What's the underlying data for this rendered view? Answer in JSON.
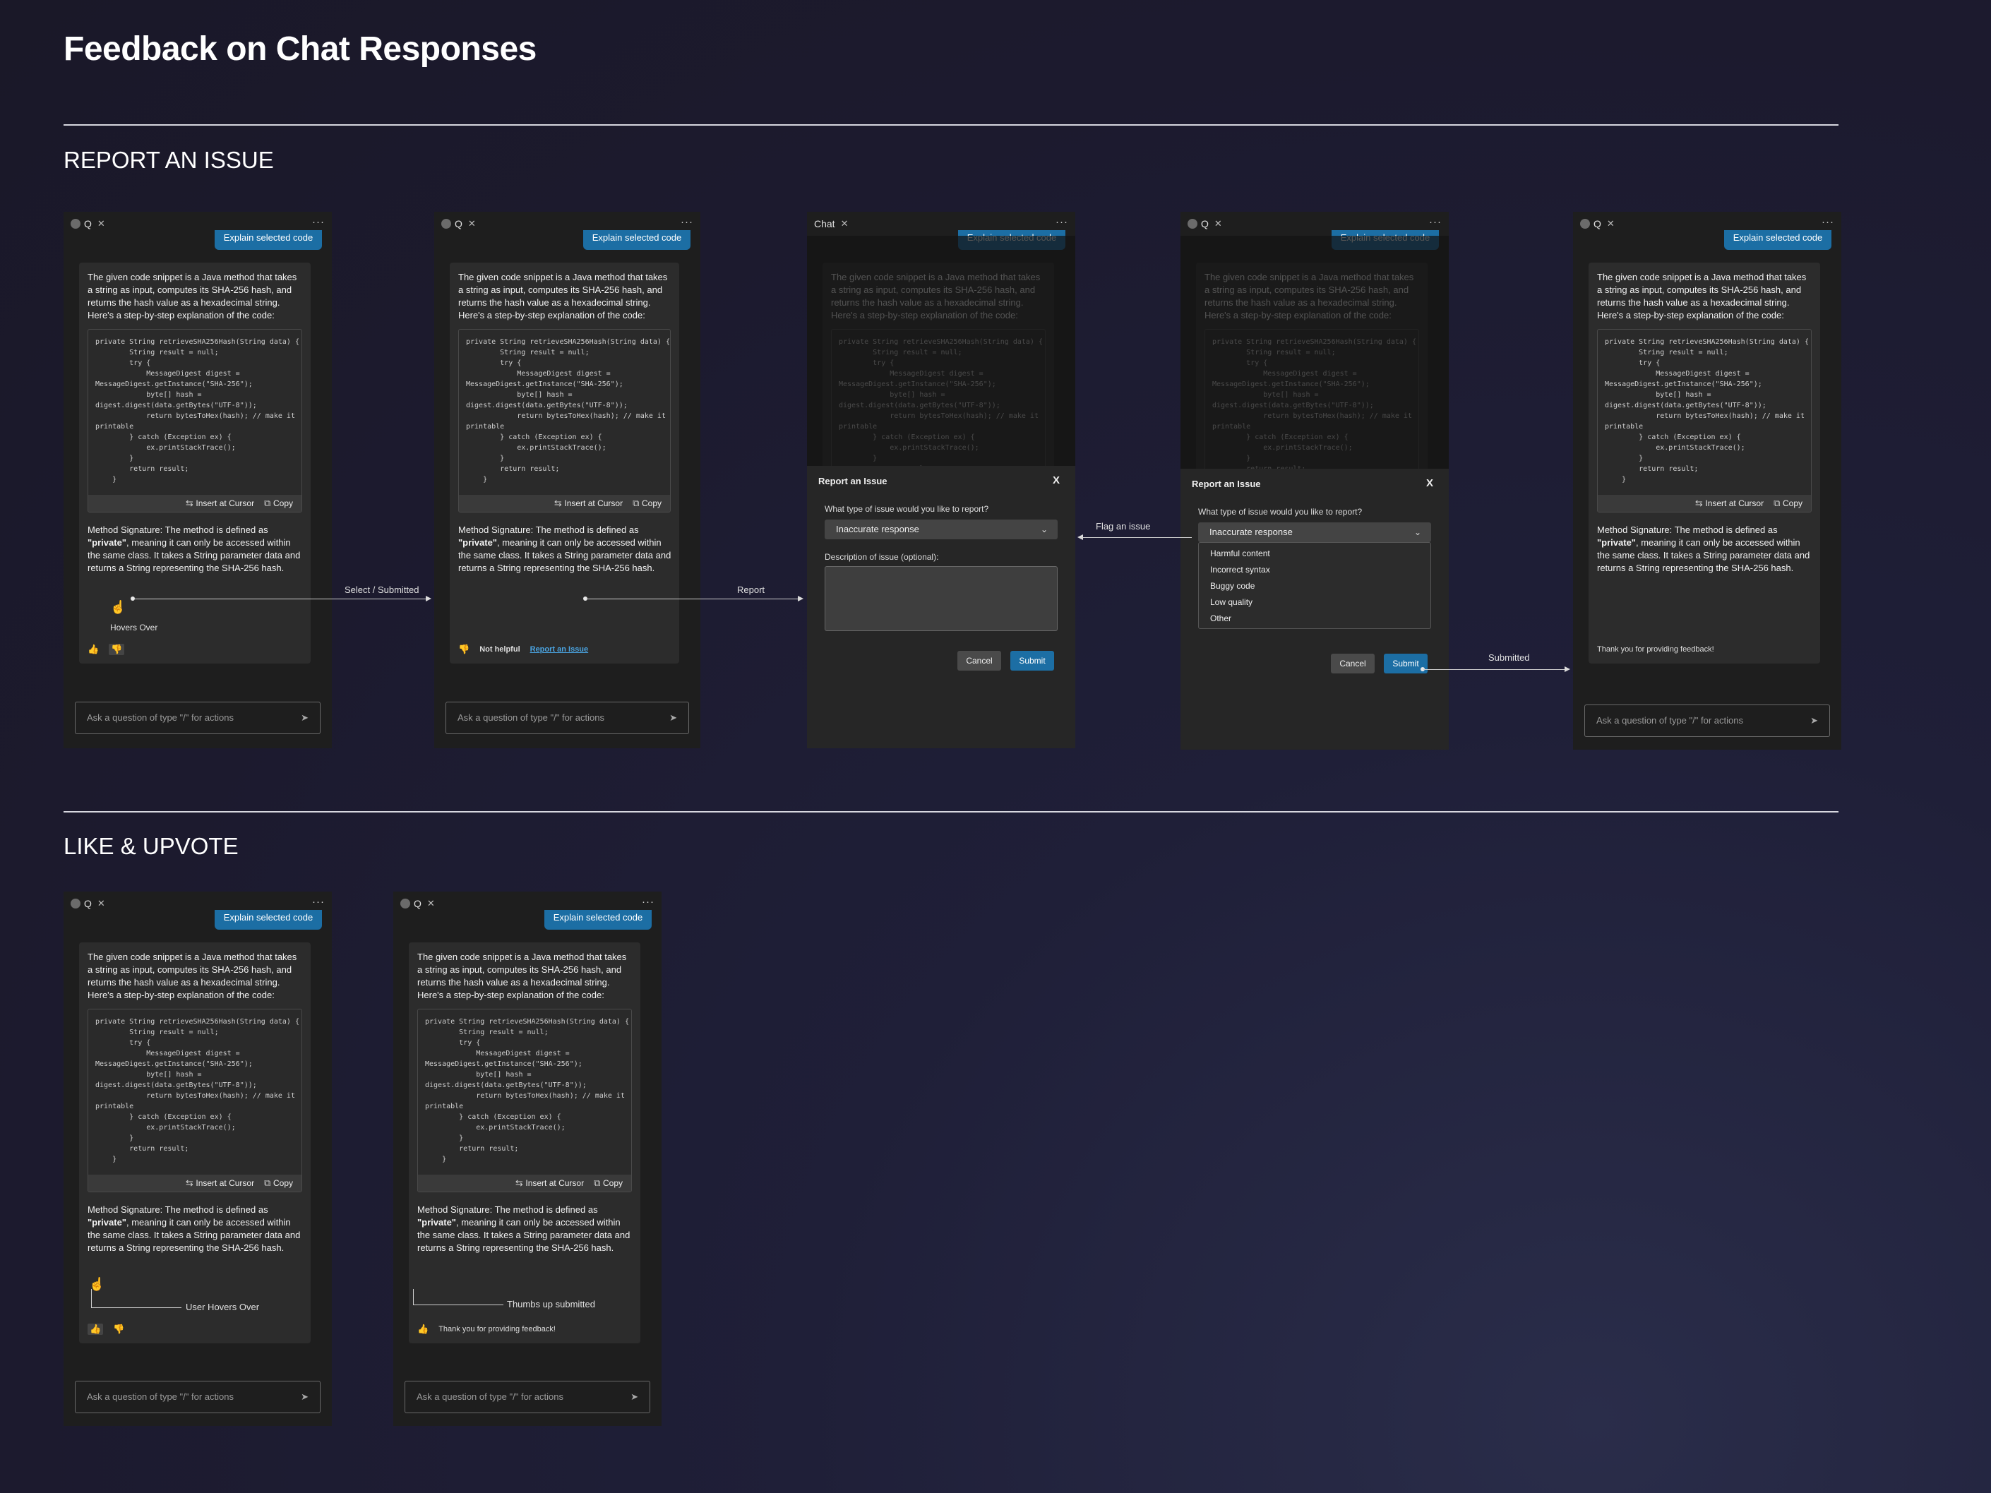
{
  "page": {
    "title": "Feedback on Chat Responses",
    "sections": {
      "report": "REPORT AN ISSUE",
      "like": "LIKE & UPVOTE"
    }
  },
  "panel": {
    "tab_label": "Q",
    "chat_tab_label": "Chat",
    "close_glyph": "✕",
    "more_glyph": "···",
    "explain_button": "Explain selected code",
    "intro_text": "The given code snippet is a Java method that takes a string as input, computes its SHA-256 hash, and returns the hash value as a hexadecimal string. Here's a step-by-step explanation of the code:",
    "code_lines": [
      "private String retrieveSHA256Hash(String data) {",
      "        String result = null;",
      "        try {",
      "            MessageDigest digest =",
      "MessageDigest.getInstance(\"SHA-256\");",
      "            byte[] hash =",
      "digest.digest(data.getBytes(\"UTF-8\"));",
      "            return bytesToHex(hash); // make it",
      "printable",
      "        } catch (Exception ex) {",
      "            ex.printStackTrace();",
      "        }",
      "        return result;",
      "    }"
    ],
    "insert_at_cursor": "Insert at Cursor",
    "copy": "Copy",
    "signature_prefix": "Method Signature: The method is defined as ",
    "signature_bold": "\"private\"",
    "signature_suffix": ", meaning it can only be accessed within the same class. It takes a String parameter data and returns a String representing the SHA-256 hash.",
    "input_placeholder": "Ask a question of type \"/\" for actions",
    "not_helpful": "Not helpful",
    "report_link": "Report an Issue",
    "thanks": "Thank you for providing feedback!"
  },
  "modal": {
    "title": "Report an Issue",
    "close": "X",
    "question": "What type of issue would you like to report?",
    "selected": "Inaccurate response",
    "description_label": "Description of issue (optional):",
    "cancel": "Cancel",
    "submit": "Submit",
    "options": [
      "Harmful content",
      "Incorrect syntax",
      "Buggy code",
      "Low quality",
      "Other"
    ]
  },
  "annotations": {
    "hovers_over": "Hovers Over",
    "select_submitted": "Select / Submitted",
    "report": "Report",
    "flag_issue": "Flag an issue",
    "submitted": "Submitted",
    "user_hovers_over": "User Hovers Over",
    "thumbs_up_submitted": "Thumbs up submitted"
  },
  "colors": {
    "accent": "#1c6ea4",
    "link": "#4aa3e0",
    "panel_bg": "#1e1e1e",
    "card_bg": "#2c2c2c"
  }
}
